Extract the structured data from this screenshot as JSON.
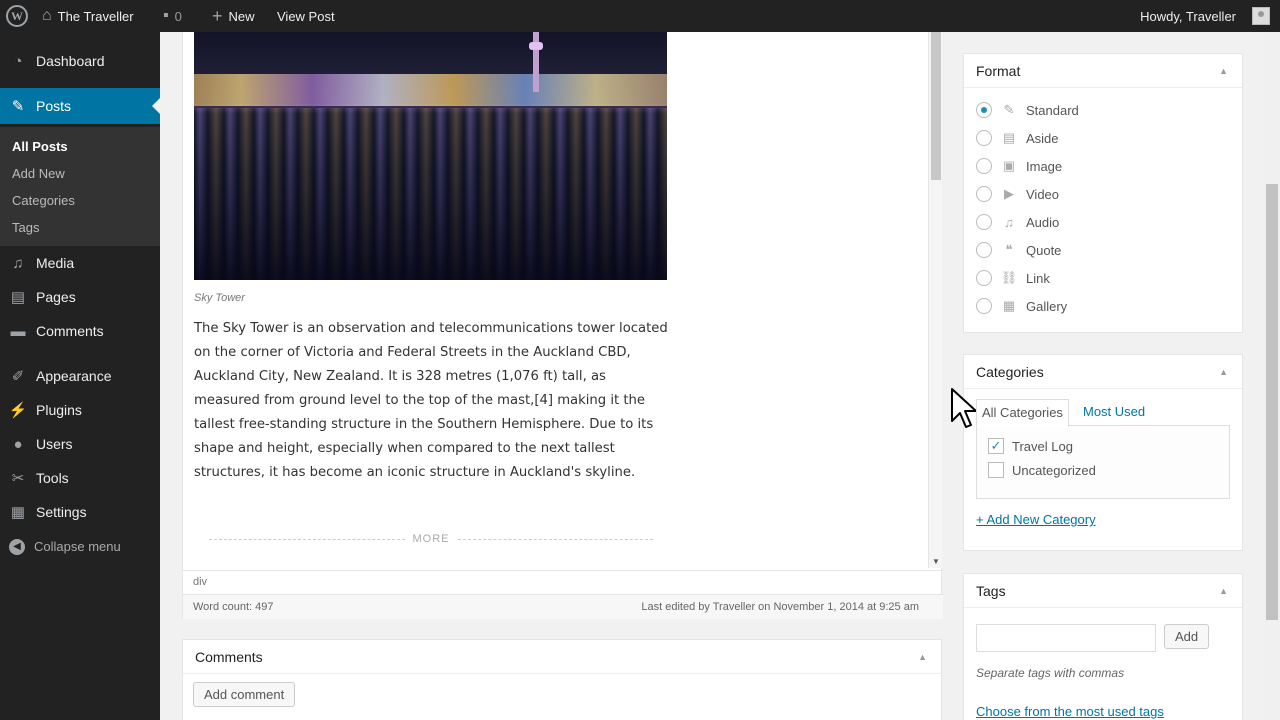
{
  "adminbar": {
    "site_name": "The Traveller",
    "comments_count": "0",
    "new_label": "New",
    "view_post_label": "View Post",
    "howdy": "Howdy, Traveller"
  },
  "sidebar": {
    "dashboard": "Dashboard",
    "posts": "Posts",
    "submenu": [
      "All Posts",
      "Add New",
      "Categories",
      "Tags"
    ],
    "media": "Media",
    "pages": "Pages",
    "comments": "Comments",
    "appearance": "Appearance",
    "plugins": "Plugins",
    "users": "Users",
    "tools": "Tools",
    "settings": "Settings",
    "collapse": "Collapse menu"
  },
  "editor": {
    "image_caption": "Sky Tower",
    "body": "The Sky Tower is an observation and telecommunications tower located on the corner of Victoria and Federal Streets in the Auckland CBD, Auckland City, New Zealand. It is 328 metres (1,076 ft) tall, as measured from ground level to the top of the mast,[4] making it the tallest free-standing structure in the Southern Hemisphere. Due to its shape and height, especially when compared to the next tallest structures, it has become an iconic structure in Auckland's skyline.",
    "more_label": "MORE",
    "path": "div",
    "word_count": "Word count: 497",
    "last_edited": "Last edited by Traveller on November 1, 2014 at 9:25 am"
  },
  "comments_box": {
    "title": "Comments",
    "add_button": "Add comment"
  },
  "format_box": {
    "title": "Format",
    "options": [
      "Standard",
      "Aside",
      "Image",
      "Video",
      "Audio",
      "Quote",
      "Link",
      "Gallery"
    ],
    "selected": "Standard"
  },
  "categories_box": {
    "title": "Categories",
    "tab_all": "All Categories",
    "tab_used": "Most Used",
    "items": [
      {
        "label": "Travel Log",
        "checked": true
      },
      {
        "label": "Uncategorized",
        "checked": false
      }
    ],
    "add_link": "+ Add New Category"
  },
  "tags_box": {
    "title": "Tags",
    "input_value": "",
    "add_button": "Add",
    "hint": "Separate tags with commas",
    "choose_link": "Choose from the most used tags"
  },
  "colors": {
    "accent": "#0074a2",
    "sidebar": "#222222",
    "background": "#f1f1f1"
  }
}
